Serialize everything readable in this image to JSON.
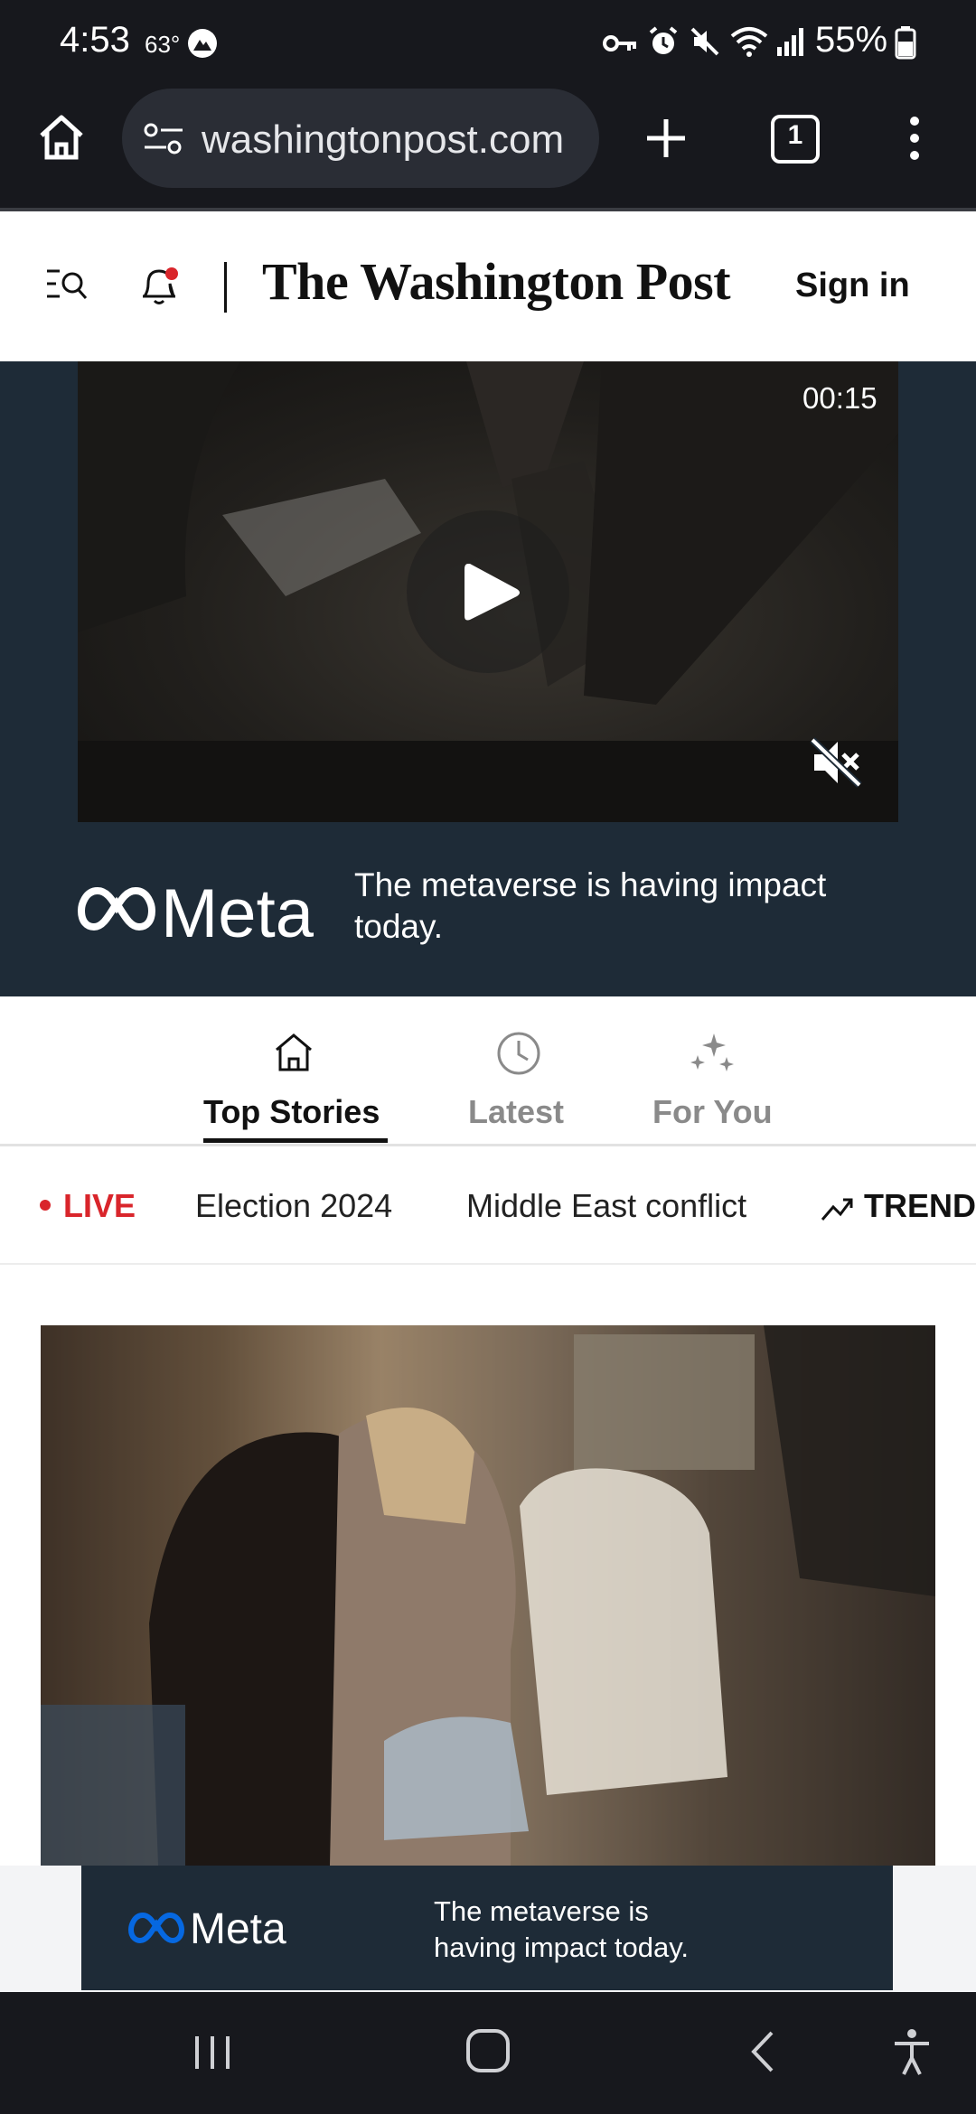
{
  "status_bar": {
    "time": "4:53",
    "temperature": "63°",
    "battery": "55%",
    "icons": [
      "key-icon",
      "alarm-icon",
      "mute-icon",
      "wifi-icon",
      "signal-icon",
      "battery-icon"
    ]
  },
  "browser": {
    "url": "washingtonpost.com",
    "tab_count": "1",
    "icons": [
      "home-icon",
      "site-settings-icon",
      "new-tab-icon",
      "tab-switcher-icon",
      "more-menu-icon"
    ]
  },
  "header": {
    "logo": "The Washington Post",
    "sign_in": "Sign in",
    "icons": [
      "menu-search-icon",
      "notifications-bell-icon"
    ]
  },
  "ad_top": {
    "video_time": "00:15",
    "brand": "Meta",
    "tagline": "The metaverse is having impact today.",
    "icons": [
      "play-icon",
      "muted-speaker-icon",
      "meta-infinity-logo"
    ]
  },
  "tabs": [
    {
      "label": "Top Stories",
      "active": true,
      "icon": "home-outline-icon"
    },
    {
      "label": "Latest",
      "active": false,
      "icon": "clock-icon"
    },
    {
      "label": "For You",
      "active": false,
      "icon": "sparkle-icon"
    }
  ],
  "topics": {
    "live": "LIVE",
    "items": [
      "Election 2024",
      "Middle East conflict"
    ],
    "trending": "TREND",
    "trending_icon": "trending-up-icon"
  },
  "ad_bottom": {
    "brand": "Meta",
    "tagline": "The metaverse is having impact today."
  },
  "nav_bar": {
    "icons": [
      "recent-apps-icon",
      "home-button-icon",
      "back-icon",
      "accessibility-icon"
    ]
  },
  "colors": {
    "live_red": "#d9252b",
    "ad_background": "#1e2b37",
    "system_bar": "#17181d",
    "meta_blue": "#0668e1"
  }
}
